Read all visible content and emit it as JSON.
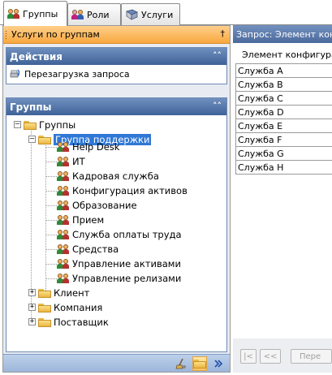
{
  "tabs": [
    {
      "label": "Группы",
      "icon": "people-icon",
      "active": true
    },
    {
      "label": "Роли",
      "icon": "roles-icon",
      "active": false
    },
    {
      "label": "Услуги",
      "icon": "book-icon",
      "active": false
    }
  ],
  "left_pane": {
    "title": "Услуги по группам",
    "pin_glyph": "†",
    "actions_group": {
      "title": "Действия",
      "items": [
        {
          "label": "Перезагрузка запроса",
          "icon": "reload-icon"
        }
      ]
    },
    "groups_group": {
      "title": "Группы",
      "tree": {
        "root": "Группы",
        "support_group": "Группа поддержки",
        "support_children": [
          "Help Desk",
          "ИТ",
          "Кадровая служба",
          "Конфигурация активов",
          "Образование",
          "Прием",
          "Служба оплаты труда",
          "Средства",
          "Управление активами",
          "Управление релизами"
        ],
        "other_groups": [
          "Клиент",
          "Компания",
          "Поставщик"
        ]
      }
    },
    "collapse_glyph": "˄˄"
  },
  "right_pane": {
    "title": "Запрос: Элемент конфигурации",
    "column_header": "Элемент конфигурации",
    "rows": [
      "Служба A",
      "Служба B",
      "Служба C",
      "Служба D",
      "Служба E",
      "Служба F",
      "Служба G",
      "Служба H"
    ],
    "nav": {
      "first": "|<",
      "prev": "<<",
      "next": "Пере"
    }
  },
  "colors": {
    "accent_orange": "#f8a840",
    "group_header_blue": "#3f6297",
    "selection_blue": "#2f78d6"
  }
}
